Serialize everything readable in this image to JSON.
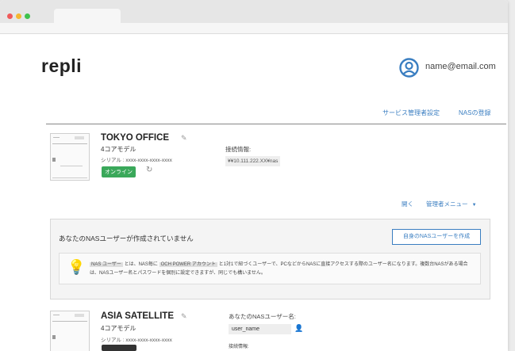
{
  "app": {
    "logo": "repli",
    "user_email": "name@email.com"
  },
  "header_nav": {
    "service_admin_settings": "サービス管理者設定",
    "nas_register": "NASの登録"
  },
  "nas_list": [
    {
      "name": "TOKYO OFFICE",
      "model": "4コアモデル",
      "serial": "シリアル : xxxx-xxxx-xxxx-xxxx",
      "status": "オンライン",
      "connection_label": "接続情報:",
      "connection_address": "¥¥10.111.222.XX¥nas",
      "open_link": "開く",
      "admin_menu": "管理者メニュー"
    },
    {
      "name": "ASIA SATELLITE",
      "model": "4コアモデル",
      "serial": "シリアル : xxxx-xxxx-xxxx-xxxx",
      "nas_user_label": "あなたのNASユーザー名:",
      "nas_user_value": "user_name",
      "connection_label_partial": "接続情報:"
    }
  ],
  "notice": {
    "title": "あなたのNASユーザーが作成されていません",
    "create_button": "自身のNASユーザーを作成",
    "tag_nas_user": "NAS ユーザー",
    "text_part1": "とは、NAS毎に",
    "tag_och_account": "OCH POWER アカウント",
    "text_part2": "と1対1で紐づくユーザーで、PCなどからNASに直接アクセスする際のユーザー名になります。複数台NASがある場合は、NASユーザー名とパスワードを個別に設定できますが、同じでも構いません。"
  },
  "colors": {
    "accent_blue": "#3a7ec1",
    "online_green": "#3aa85a",
    "traffic_red": "#f05a5a",
    "traffic_yellow": "#f5b731",
    "traffic_green": "#3fc24d"
  },
  "icons": {
    "avatar": "user-circle-icon",
    "edit": "pencil-icon",
    "refresh": "refresh-icon",
    "dropdown": "caret-down-icon",
    "tip": "lightbulb-icon",
    "user_edit": "user-edit-icon"
  }
}
